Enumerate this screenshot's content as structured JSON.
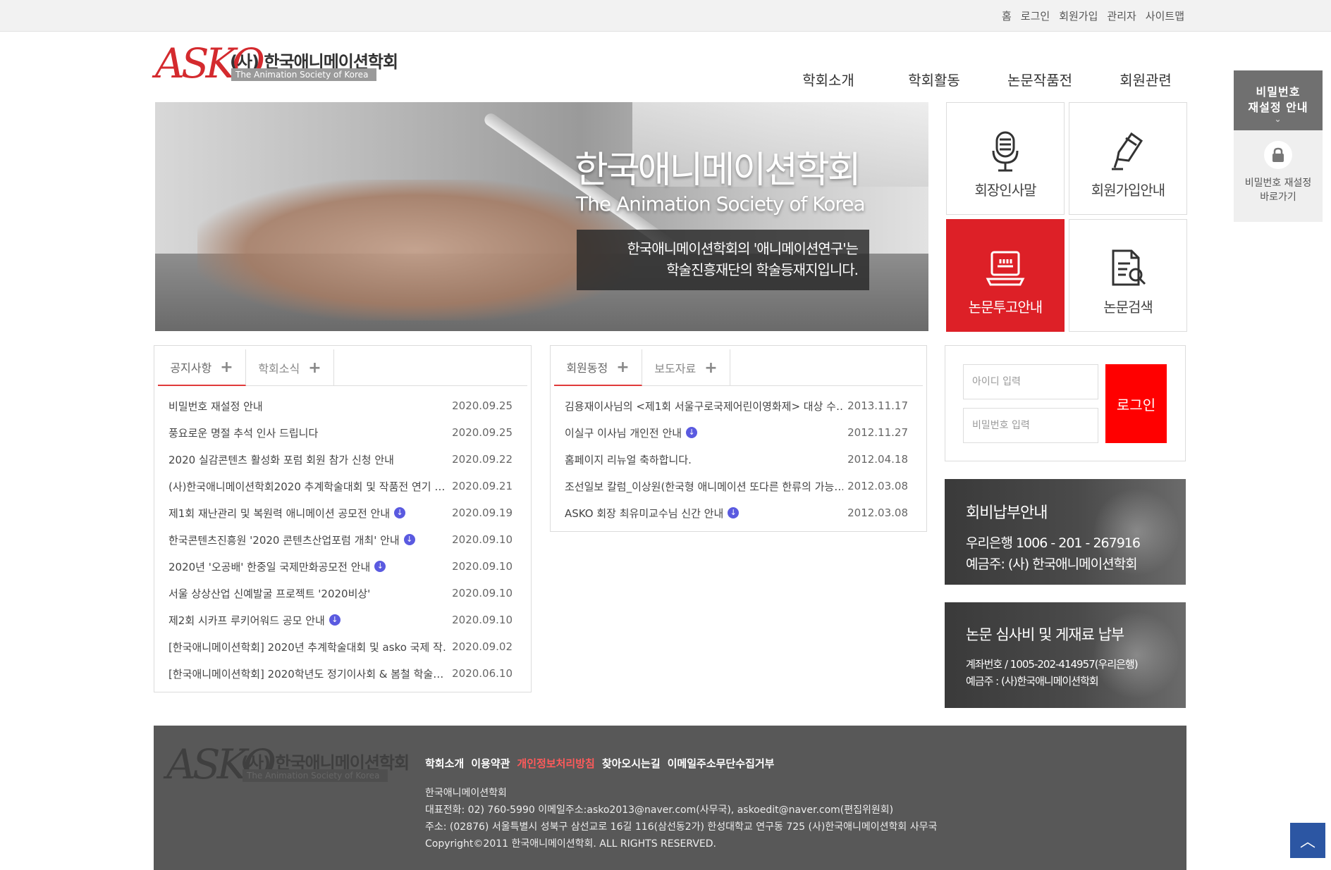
{
  "topbar": {
    "links": [
      "홈",
      "로그인",
      "회원가입",
      "관리자",
      "사이트맵"
    ]
  },
  "logo": {
    "mark": "ASKO",
    "korean": "(사) 한국애니메이션학회",
    "english": "The Animation Society of Korea"
  },
  "gnb": [
    "학회소개",
    "학회활동",
    "논문작품전",
    "회원관련"
  ],
  "banner": {
    "title": "한국애니메이션학회",
    "subtitle": "The Animation Society of Korea",
    "notice_line1": "한국애니메이션학회의 '애니메이션연구'는",
    "notice_line2": "학술진흥재단의 학술등재지입니다."
  },
  "quick_menu": [
    {
      "label": "회장인사말",
      "icon": "microphone-icon"
    },
    {
      "label": "회원가입안내",
      "icon": "pen-icon"
    },
    {
      "label": "논문투고안내",
      "icon": "laptop-icon"
    },
    {
      "label": "논문검색",
      "icon": "document-search-icon"
    }
  ],
  "notice_box": {
    "tabs": [
      "공지사항",
      "학회소식"
    ],
    "items": [
      {
        "title": "비밀번호 재설정 안내",
        "date": "2020.09.25",
        "download": false
      },
      {
        "title": "풍요로운 명절 추석 인사 드립니다",
        "date": "2020.09.25",
        "download": false
      },
      {
        "title": "2020 실감콘텐츠 활성화 포럼 회원 참가 신청 안내",
        "date": "2020.09.22",
        "download": false
      },
      {
        "title": "(사)한국애니메이션학회2020 추계학술대회 및 작품전 연기 …",
        "date": "2020.09.21",
        "download": false
      },
      {
        "title": "제1회 재난관리 및 복원력 애니메이션 공모전 안내",
        "date": "2020.09.19",
        "download": true
      },
      {
        "title": "한국콘텐츠진흥원 '2020 콘텐츠산업포럼 개최' 안내",
        "date": "2020.09.10",
        "download": true
      },
      {
        "title": "2020년 '오공배' 한중일 국제만화공모전 안내",
        "date": "2020.09.10",
        "download": true
      },
      {
        "title": "서울 상상산업 신예발굴 프로젝트 '2020비상'",
        "date": "2020.09.10",
        "download": false
      },
      {
        "title": "제2회 시카프 루키어워드 공모 안내",
        "date": "2020.09.10",
        "download": true
      },
      {
        "title": "[한국애니메이션학회] 2020년 추계학술대회 및 asko 국제 작…",
        "date": "2020.09.02",
        "download": false
      },
      {
        "title": "[한국애니메이션학회] 2020학년도 정기이사회 & 봄철 학술…",
        "date": "2020.06.10",
        "download": false
      }
    ]
  },
  "member_box": {
    "tabs": [
      "회원동정",
      "보도자료"
    ],
    "items": [
      {
        "title": "김용재이사님의 <제1회 서울구로국제어린이영화제> 대상 수…",
        "date": "2013.11.17",
        "download": false
      },
      {
        "title": "이실구 이사님 개인전 안내",
        "date": "2012.11.27",
        "download": true
      },
      {
        "title": "홈페이지 리뉴얼 축하합니다.",
        "date": "2012.04.18",
        "download": false
      },
      {
        "title": "조선일보 칼럼_이상원(한국형 애니메이션 또다른 한류의 가능…",
        "date": "2012.03.08",
        "download": false
      },
      {
        "title": "ASKO 회장 최유미교수님 신간 안내",
        "date": "2012.03.08",
        "download": true
      }
    ]
  },
  "login": {
    "id_placeholder": "아이디 입력",
    "pw_placeholder": "비밀번호 입력",
    "button": "로그인"
  },
  "fee_box": {
    "title": "회비납부안내",
    "account": "우리은행 1006 - 201  - 267916",
    "holder": "예금주: (사) 한국애니메이션학회"
  },
  "review_box": {
    "title": "논문 심사비 및 게재료 납부",
    "account": "계좌번호 / 1005-202-414957(우리은행)",
    "holder": "예금주 : (사)한국애니메이션학회"
  },
  "side_reset": {
    "head_line1": "비밀번호",
    "head_line2": "재설정 안내",
    "text_line1": "비밀번호 재설정",
    "text_line2": "바로가기"
  },
  "footer": {
    "links": [
      "학회소개",
      "이용약관",
      "개인정보처리방침",
      "찾아오시는길",
      "이메일주소무단수집거부"
    ],
    "org": "한국애니메이션학회",
    "contact": "대표전화: 02) 760-5990    이메일주소:asko2013@naver.com(사무국),    askoedit@naver.com(편집위원회)",
    "address": "주소: (02876) 서울특별시 성북구 삼선교로 16길 116(삼선동2가) 한성대학교 연구동 725 (사)한국애니메이션학회 사무국",
    "copyright": "Copyright©2011 한국애니메이션학회. ALL RIGHTS RESERVED."
  },
  "colors": {
    "accent_red": "#dd2027",
    "login_red": "#ff0000",
    "top_button_blue": "#2c56a3",
    "footer_bg": "#585858"
  }
}
